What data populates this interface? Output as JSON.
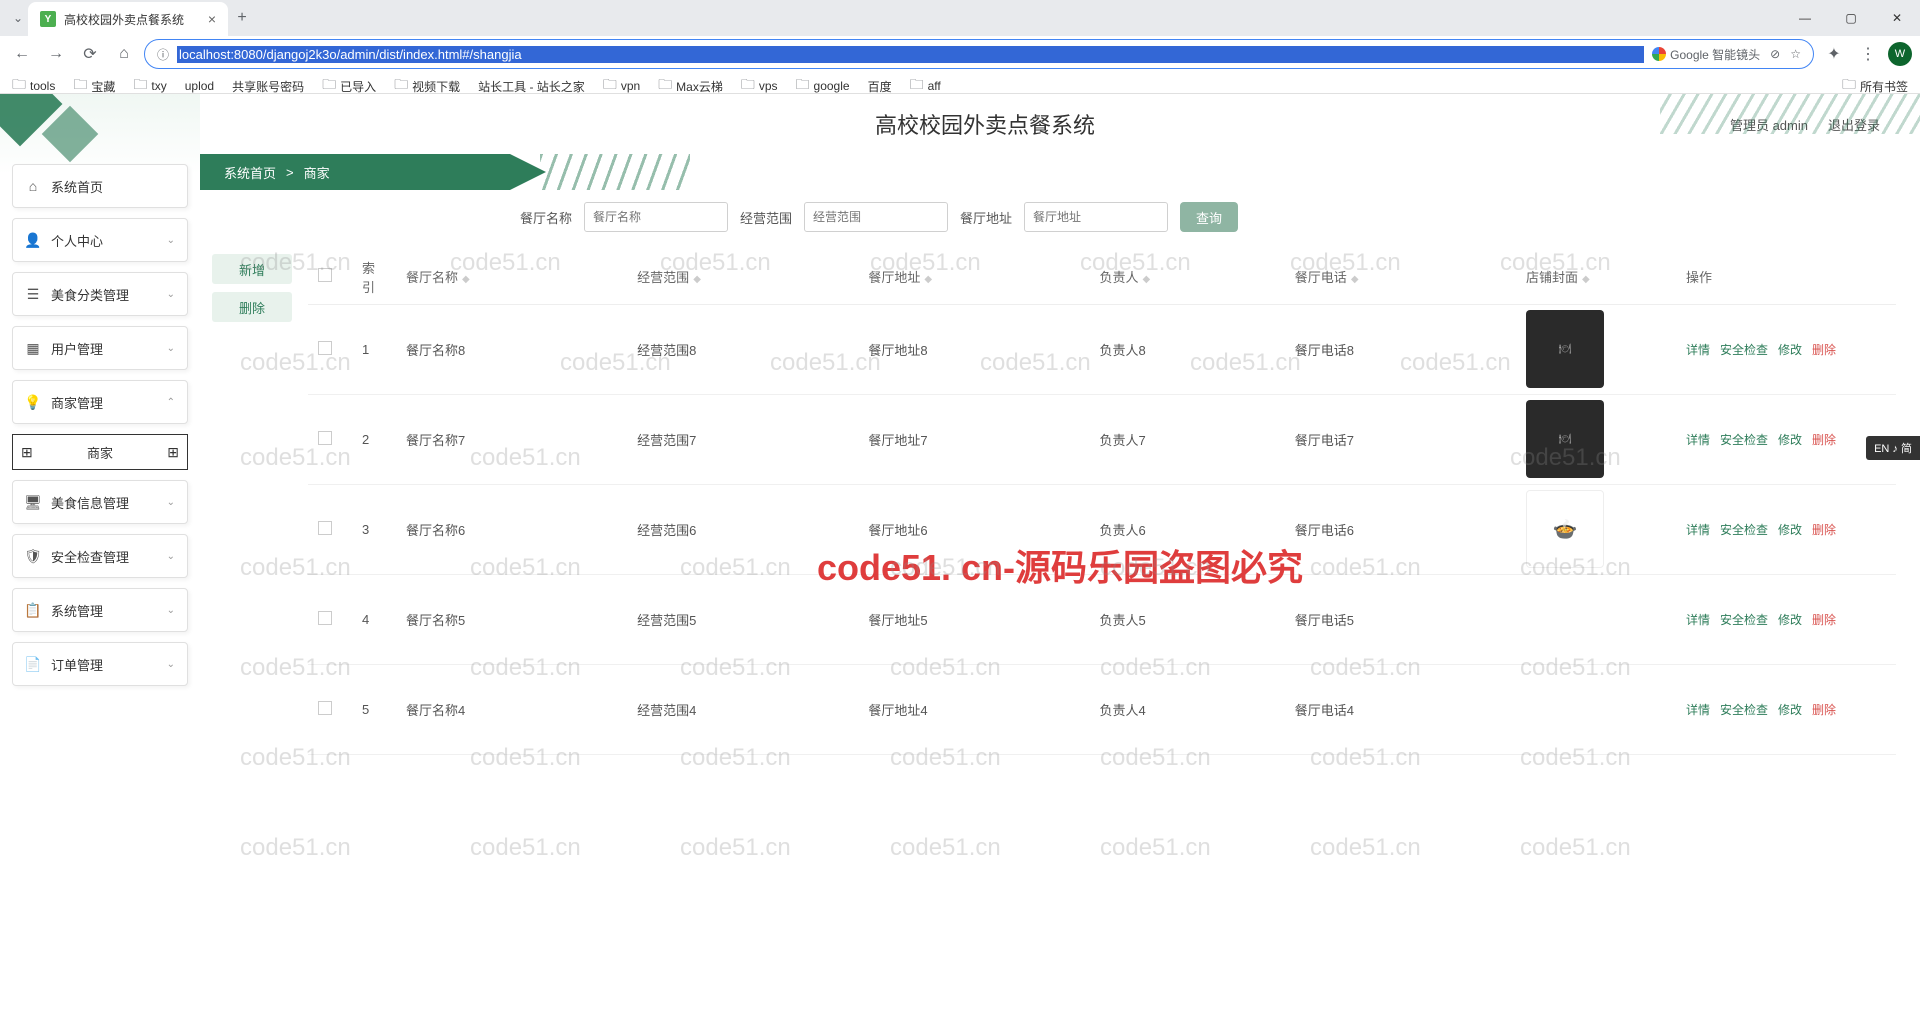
{
  "browser": {
    "tab_title": "高校校园外卖点餐系统",
    "url": "localhost:8080/djangoj2k3o/admin/dist/index.html#/shangjia",
    "lens_label": "Google 智能镜头",
    "bookmarks": [
      "tools",
      "宝藏",
      "txy",
      "uplod",
      "共享账号密码",
      "已导入",
      "视频下载",
      "站长工具 - 站长之家",
      "vpn",
      "Max云梯",
      "vps",
      "google",
      "百度",
      "aff"
    ],
    "all_bookmarks": "所有书签",
    "profile": "W"
  },
  "app": {
    "title": "高校校园外卖点餐系统",
    "user_label": "管理员 admin",
    "logout": "退出登录"
  },
  "breadcrumb": {
    "home": "系统首页",
    "sep": ">",
    "current": "商家"
  },
  "sidebar": {
    "items": [
      {
        "icon": "⌂",
        "label": "系统首页",
        "expand": ""
      },
      {
        "icon": "👤",
        "label": "个人中心",
        "expand": "⌄"
      },
      {
        "icon": "☰",
        "label": "美食分类管理",
        "expand": "⌄"
      },
      {
        "icon": "▦",
        "label": "用户管理",
        "expand": "⌄"
      },
      {
        "icon": "💡",
        "label": "商家管理",
        "expand": "⌃"
      },
      {
        "icon": "",
        "label": "商家",
        "expand": "",
        "sub": true
      },
      {
        "icon": "🖥",
        "label": "美食信息管理",
        "expand": "⌄"
      },
      {
        "icon": "🛡",
        "label": "安全检查管理",
        "expand": "⌄"
      },
      {
        "icon": "📋",
        "label": "系统管理",
        "expand": "⌄"
      },
      {
        "icon": "📄",
        "label": "订单管理",
        "expand": "⌄"
      }
    ]
  },
  "search": {
    "f1_label": "餐厅名称",
    "f1_ph": "餐厅名称",
    "f2_label": "经营范围",
    "f2_ph": "经营范围",
    "f3_label": "餐厅地址",
    "f3_ph": "餐厅地址",
    "btn": "查询"
  },
  "actions": {
    "add": "新增",
    "delete": "删除"
  },
  "table": {
    "cols": {
      "idx": "索引",
      "name": "餐厅名称",
      "scope": "经营范围",
      "addr": "餐厅地址",
      "owner": "负责人",
      "phone": "餐厅电话",
      "cover": "店铺封面",
      "ops": "操作"
    },
    "ops": {
      "detail": "详情",
      "check": "安全检查",
      "edit": "修改",
      "del": "删除"
    },
    "rows": [
      {
        "idx": "1",
        "name": "餐厅名称8",
        "scope": "经营范围8",
        "addr": "餐厅地址8",
        "owner": "负责人8",
        "phone": "餐厅电话8",
        "thumb": "dark"
      },
      {
        "idx": "2",
        "name": "餐厅名称7",
        "scope": "经营范围7",
        "addr": "餐厅地址7",
        "owner": "负责人7",
        "phone": "餐厅电话7",
        "thumb": "dark"
      },
      {
        "idx": "3",
        "name": "餐厅名称6",
        "scope": "经营范围6",
        "addr": "餐厅地址6",
        "owner": "负责人6",
        "phone": "餐厅电话6",
        "thumb": "alt"
      },
      {
        "idx": "4",
        "name": "餐厅名称5",
        "scope": "经营范围5",
        "addr": "餐厅地址5",
        "owner": "负责人5",
        "phone": "餐厅电话5",
        "thumb": ""
      },
      {
        "idx": "5",
        "name": "餐厅名称4",
        "scope": "经营范围4",
        "addr": "餐厅地址4",
        "owner": "负责人4",
        "phone": "餐厅电话4",
        "thumb": ""
      }
    ]
  },
  "watermark": {
    "text": "code51.cn",
    "main": "code51. cn-源码乐园盗图必究"
  },
  "ime": "EN ♪ 简"
}
